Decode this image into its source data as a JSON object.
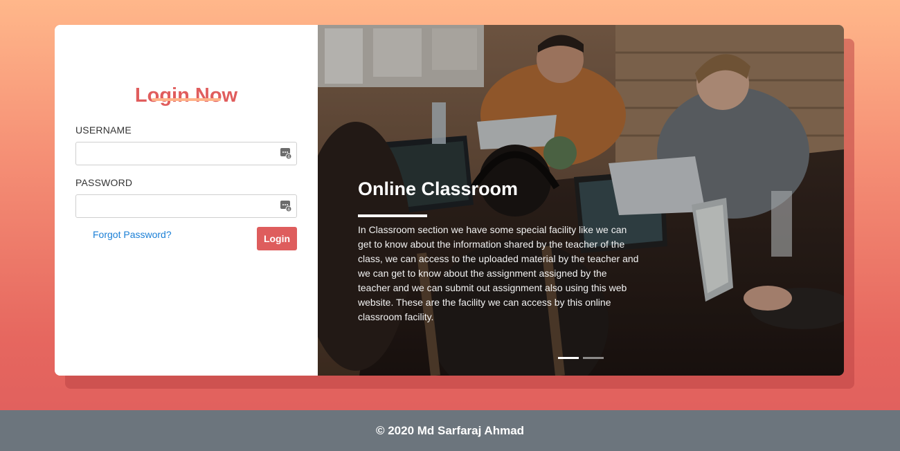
{
  "login": {
    "title": "Login Now",
    "username_label": "USERNAME",
    "username_value": "",
    "password_label": "PASSWORD",
    "password_value": "",
    "forgot_label": "Forgot Password?",
    "login_label": "Login",
    "field_icon": "password-manager-key-icon"
  },
  "hero": {
    "title": "Online Classroom",
    "description": "In Classroom section we have some special facility like we can get to know about the information shared by the teacher of the class, we can access to the uploaded material by the teacher and we can get to know about the assignment assigned by the teacher and we can submit out assignment also using this web website. These are the facility we can access by this online classroom facility.",
    "active_slide": 1,
    "slide_count": 2
  },
  "footer": {
    "text": "© 2020 Md Sarfaraj Ahmad"
  },
  "colors": {
    "accent": "#e05d5d",
    "underline": "#ffb38a",
    "link": "#1a7fd6",
    "footer_bg": "#6c757d"
  }
}
